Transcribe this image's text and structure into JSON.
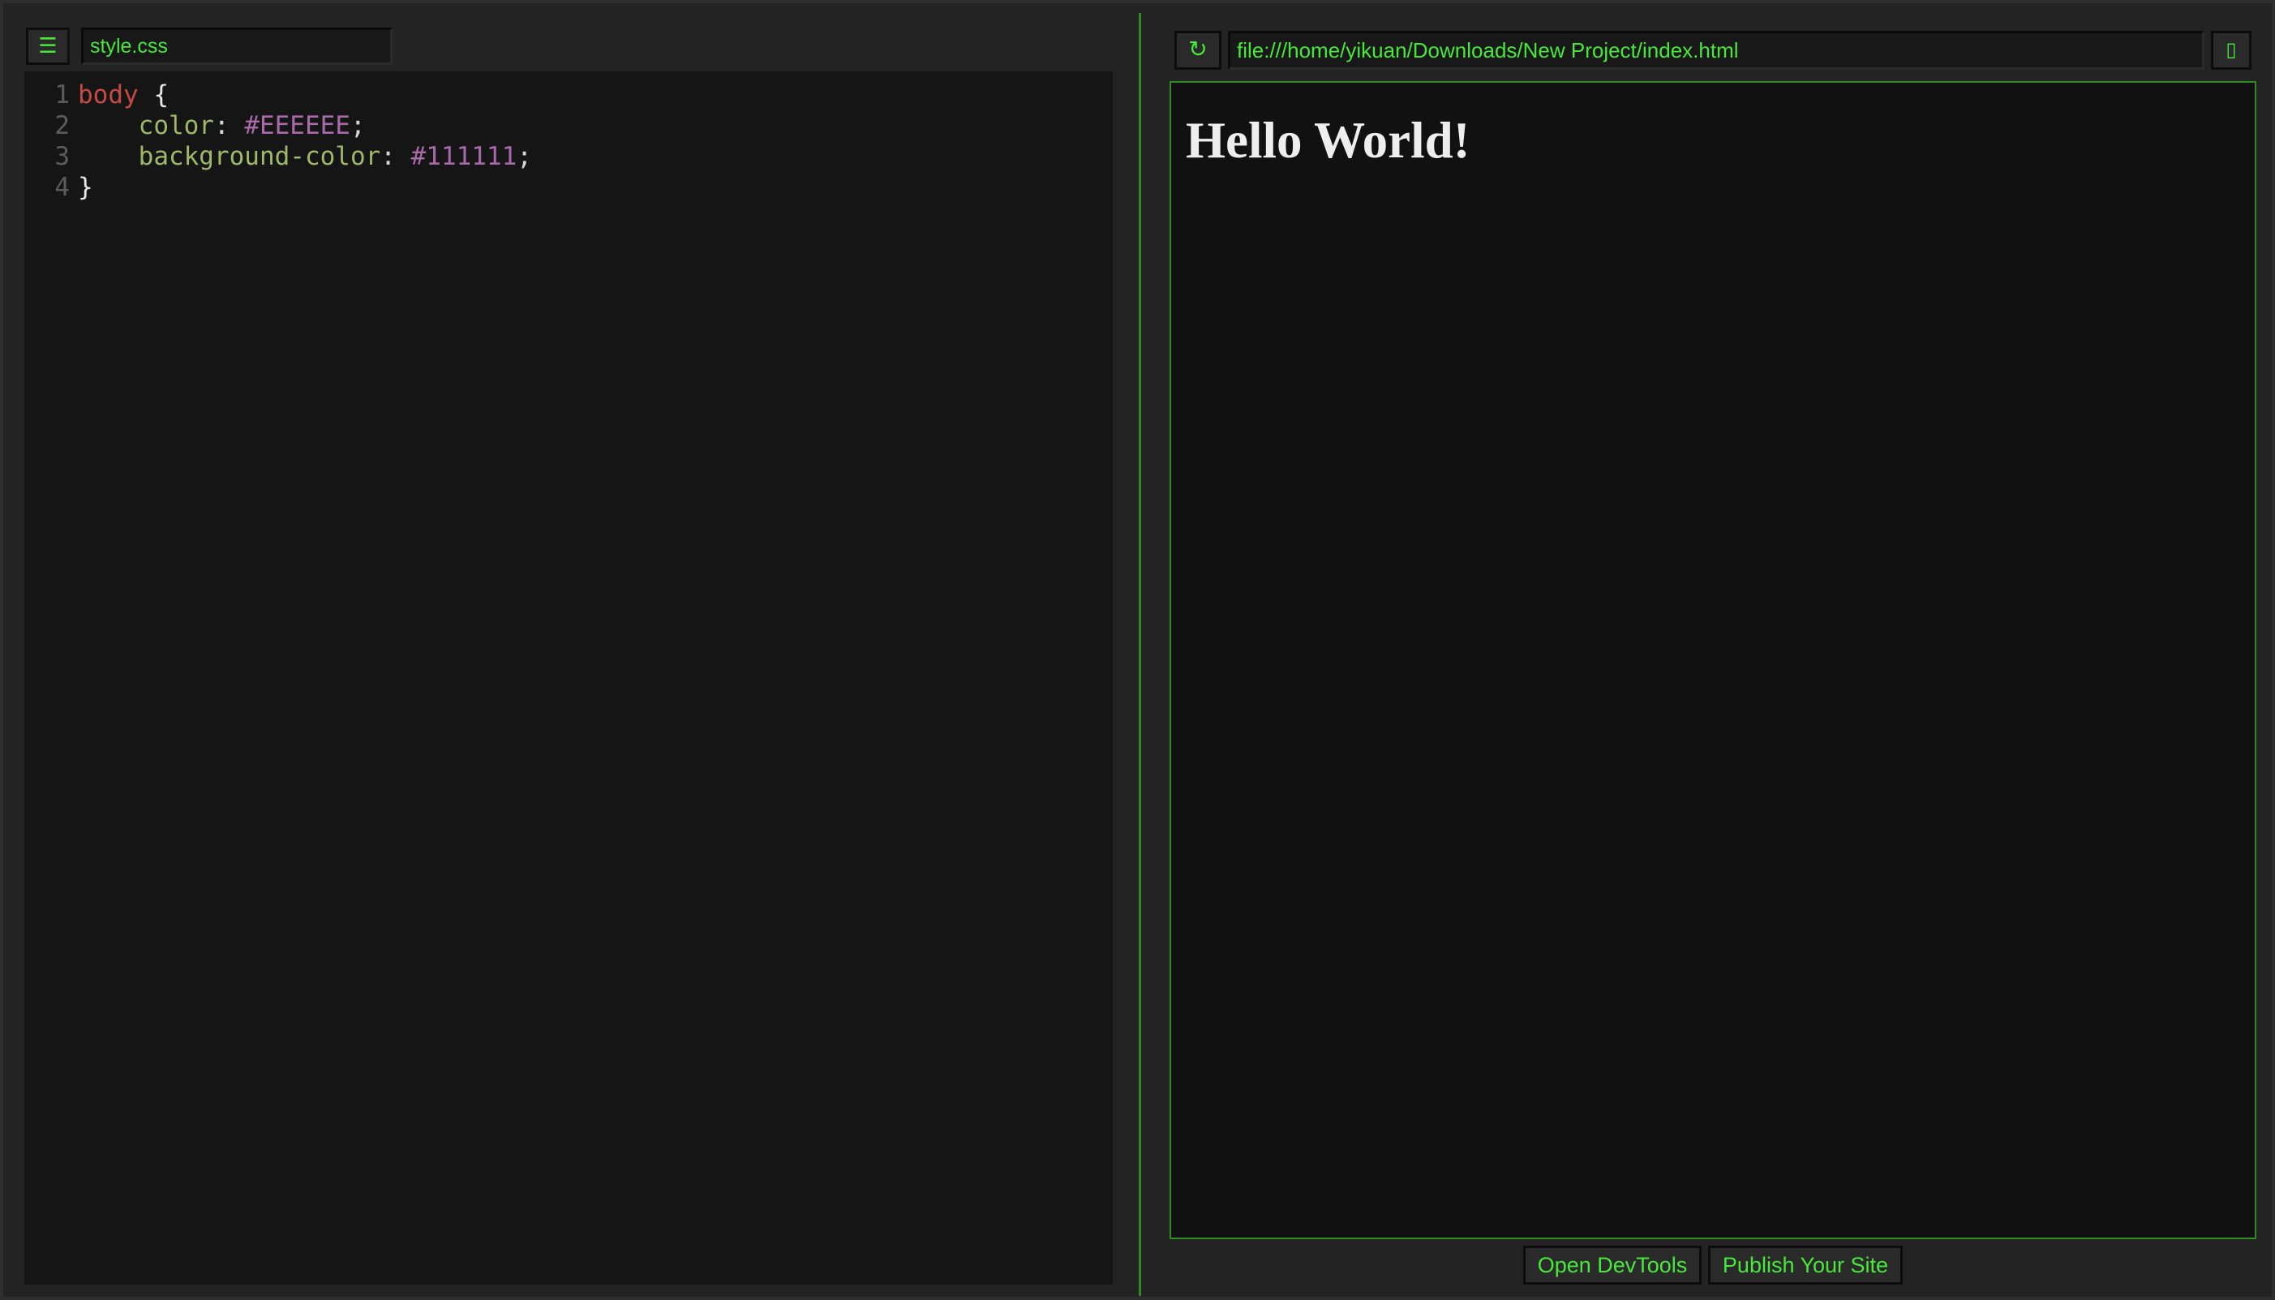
{
  "editor": {
    "menu_icon": "☰",
    "menu_icon_name": "hamburger-menu-icon",
    "filename": "style.css",
    "lines": [
      {
        "number": "1",
        "tokens": [
          {
            "type": "selector",
            "text": "body"
          },
          {
            "type": "brace",
            "text": " {"
          }
        ]
      },
      {
        "number": "2",
        "tokens": [
          {
            "type": "punct",
            "text": "    "
          },
          {
            "type": "prop",
            "text": "color"
          },
          {
            "type": "punct",
            "text": ": "
          },
          {
            "type": "value",
            "text": "#EEEEEE"
          },
          {
            "type": "punct",
            "text": ";"
          }
        ]
      },
      {
        "number": "3",
        "tokens": [
          {
            "type": "punct",
            "text": "    "
          },
          {
            "type": "prop",
            "text": "background-color"
          },
          {
            "type": "punct",
            "text": ": "
          },
          {
            "type": "value",
            "text": "#111111"
          },
          {
            "type": "punct",
            "text": ";"
          }
        ]
      },
      {
        "number": "4",
        "tokens": [
          {
            "type": "brace",
            "text": "}"
          }
        ]
      }
    ]
  },
  "preview": {
    "refresh_icon": "↻",
    "refresh_icon_name": "refresh-icon",
    "url": "file:///home/yikuan/Downloads/New Project/index.html",
    "external_icon": "▯",
    "external_icon_name": "open-external-icon",
    "heading": "Hello World!"
  },
  "footer": {
    "devtools_label": "Open DevTools",
    "publish_label": "Publish Your Site"
  },
  "colors": {
    "accent": "#48e83a",
    "divider": "#2f8a22",
    "editor_bg": "#151515",
    "window_bg": "#232323",
    "preview_bg": "#111111",
    "preview_text": "#eeeeee"
  }
}
